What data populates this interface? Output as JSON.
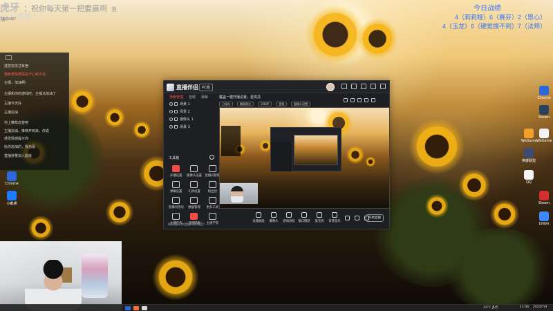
{
  "overlay": {
    "logo": "虎牙",
    "main_text": "：祝你每天第一把要赢啊",
    "badge_text": "直播！！",
    "line2_prefix": "大学",
    "line2_mid": "直播",
    "line2_suffix": "！！",
    "small_id": "16156497"
  },
  "score_board": {
    "title": "今日战绩",
    "line1": "4（莉莉娅）6（赛芬）2（恩心）",
    "line2": "4（玉龙）6（硬是搜不到）7（法师）"
  },
  "chat": {
    "lines": [
      "送您加关注有宿",
      "我和老铁感情在于心和不在",
      "主播，加油啊!",
      "主播和你的游戏时，主播马加油了",
      "主播今天好",
      "主播加油",
      "你上推荐这首吧",
      "主播加油，推荐开到来，你说",
      "感觉情感提示你",
      "给你加油的，我也是",
      "直播获量加入超级"
    ]
  },
  "desktop_icons": [
    {
      "label": "Chrome",
      "color": "#2d67d8"
    },
    {
      "label": "Steam",
      "color": "#27415f"
    },
    {
      "label": "WeGame",
      "color": "#f1a12a"
    },
    {
      "label": "英雄联盟",
      "color": "#3e4c73"
    },
    {
      "label": "QQ",
      "color": "#f3f3f3"
    },
    {
      "label": "WeGame",
      "color": "#f2f2f2"
    },
    {
      "label": "Steam",
      "color": "#d32f2f"
    },
    {
      "label": "小鹅通",
      "color": "#1b7cff"
    },
    {
      "label": "bilibili",
      "color": "#3f87ff"
    }
  ],
  "app": {
    "title": "直播伴侣",
    "tag": "PC端",
    "left_tabs": [
      "场景管理",
      "音频",
      "弹幕"
    ],
    "scenes": [
      "场景 1",
      "场景 2",
      "摄像头 1",
      "场景 3"
    ],
    "tools_title": "工具箱",
    "tools": [
      "开播设置",
      "摄像头设置",
      "直播间管理",
      "弹幕设置",
      "礼物设置",
      "粉丝团",
      "直播间活动",
      "数据管理",
      "更多工具",
      "主播任务",
      "开播提醒",
      "主播学院"
    ],
    "notice": "如何提升你直播间的热度？",
    "main_head": "覆盖一键开播设置，更高清",
    "main_chips": [
      "已保存",
      "横屏模式",
      "1080P",
      "音频",
      "摄像头设置"
    ],
    "bottom_tools": [
      "直播画面",
      "摄像头",
      "游戏进程",
      "窗口捕获",
      "麦克风",
      "背景音乐"
    ],
    "start_button": "开始直播"
  },
  "taskbar": {
    "time_text": "11:08",
    "date_text": "2022/7/4",
    "weather_text": "33°C 多云"
  }
}
